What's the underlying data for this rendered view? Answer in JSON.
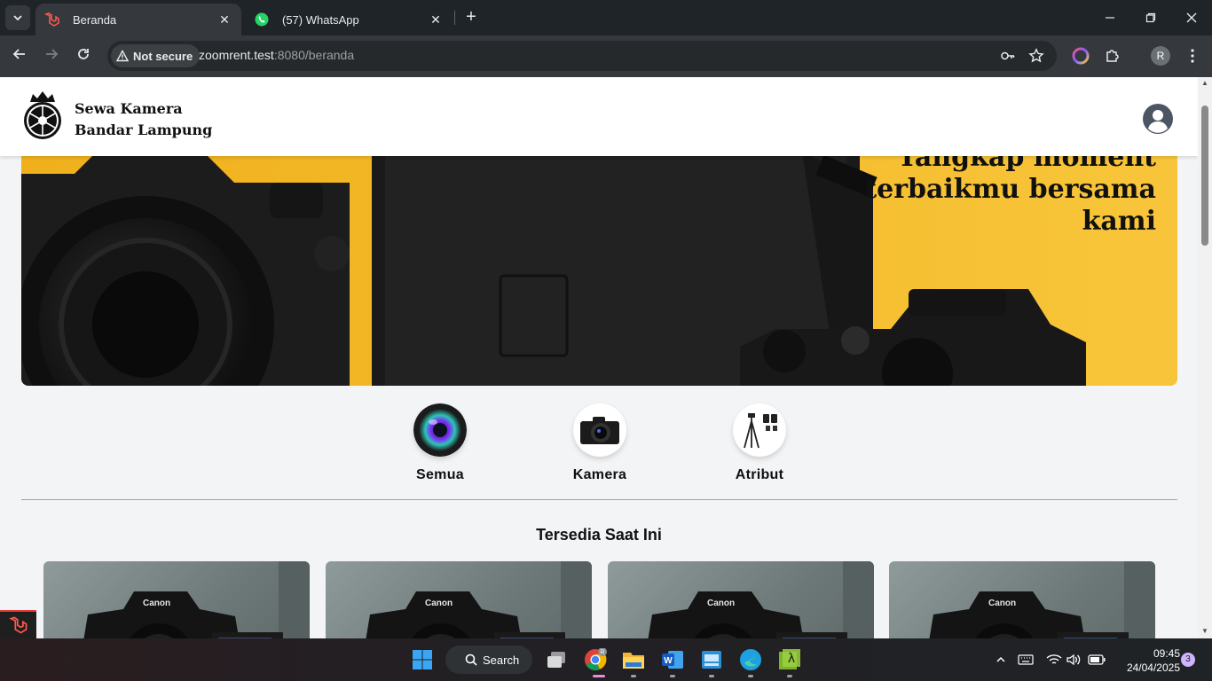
{
  "browser": {
    "tabs": [
      {
        "title": "Beranda",
        "active": true
      },
      {
        "title": "(57) WhatsApp",
        "active": false
      }
    ],
    "security_label": "Not secure",
    "url_host": "zoomrent.test",
    "url_rest": ":8080/beranda",
    "profile_initial": "R"
  },
  "site": {
    "brand_line1": "Sewa Kamera",
    "brand_line2": "Bandar Lampung",
    "hero_line1": "Tangkap moment",
    "hero_line2": "terbaikmu bersama",
    "hero_line3": "kami",
    "categories": [
      {
        "label": "Semua",
        "icon": "lens-icon"
      },
      {
        "label": "Kamera",
        "icon": "camera-icon"
      },
      {
        "label": "Atribut",
        "icon": "tripod-icon"
      }
    ],
    "section_title": "Tersedia Saat Ini",
    "card_brand": "Canon"
  },
  "taskbar": {
    "search_label": "Search",
    "time": "09:45",
    "date": "24/04/2025",
    "notifications": "3"
  },
  "colors": {
    "hero_bg": "#f5b820",
    "page_bg": "#f3f4f6",
    "browser_toolbar": "#35393d"
  }
}
